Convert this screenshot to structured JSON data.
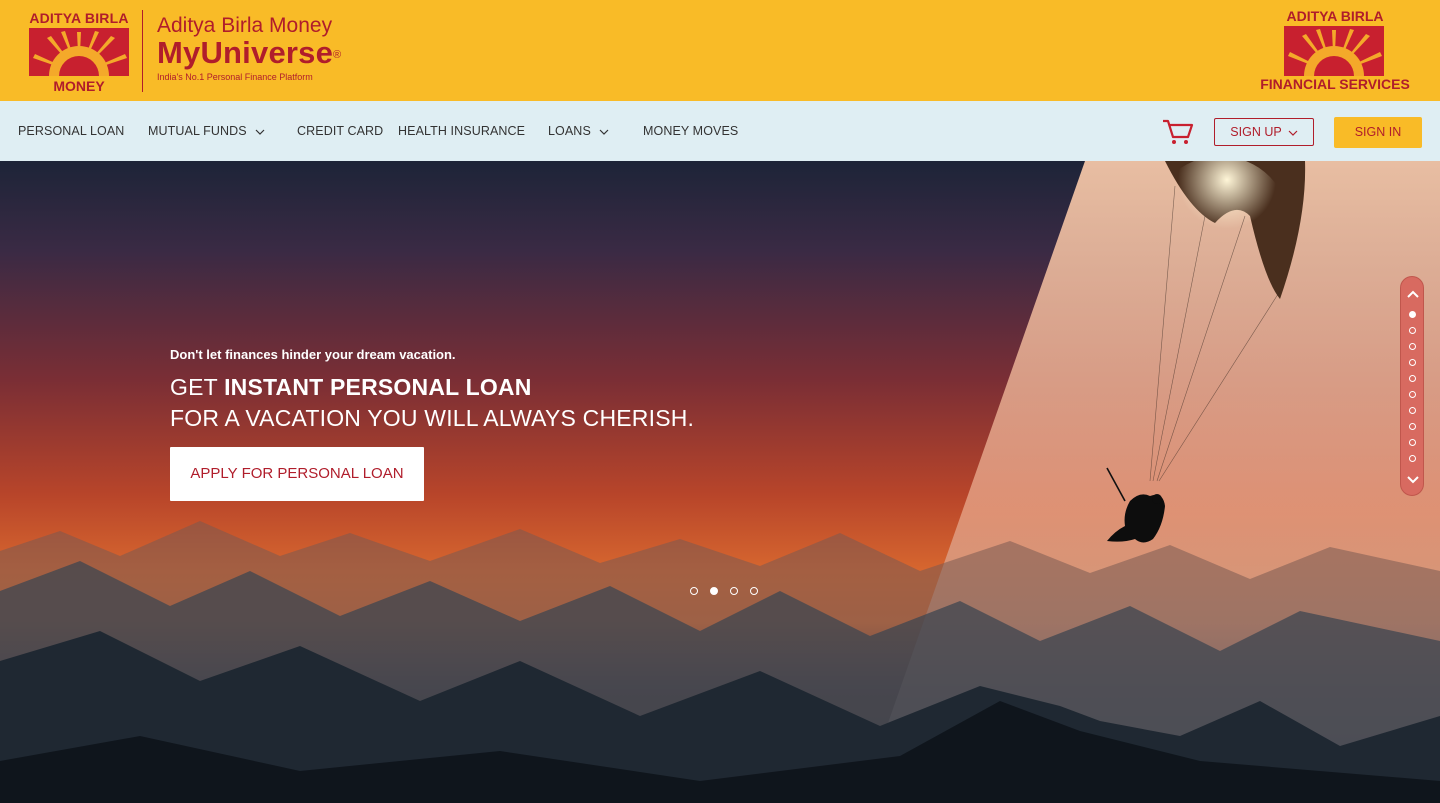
{
  "header": {
    "left_logo": {
      "top": "ADITYA BIRLA",
      "bottom": "MONEY"
    },
    "product": {
      "line1": "Aditya Birla Money",
      "line2": "MyUniverse",
      "reg": "®",
      "tagline": "India's No.1 Personal Finance Platform"
    },
    "right_logo": {
      "top": "ADITYA BIRLA",
      "bottom": "FINANCIAL SERVICES"
    },
    "brand_color": "#f9bb27",
    "accent_color": "#b01d2b"
  },
  "nav": {
    "items": [
      {
        "label": "PERSONAL LOAN",
        "has_dropdown": false
      },
      {
        "label": "MUTUAL FUNDS",
        "has_dropdown": true
      },
      {
        "label": "CREDIT CARD",
        "has_dropdown": false
      },
      {
        "label": "HEALTH INSURANCE",
        "has_dropdown": false
      },
      {
        "label": "LOANS",
        "has_dropdown": true
      },
      {
        "label": "MONEY MOVES",
        "has_dropdown": false
      }
    ],
    "cart_icon": "cart-icon",
    "signup_label": "SIGN UP",
    "signin_label": "SIGN IN"
  },
  "hero": {
    "subtitle": "Don't let finances hinder your dream vacation.",
    "headline_prefix": "GET ",
    "headline_bold": "INSTANT PERSONAL LOAN",
    "headline_line2": "FOR A VACATION YOU WILL ALWAYS CHERISH.",
    "cta_label": "APPLY FOR PERSONAL LOAN",
    "carousel_slide_count": 4,
    "carousel_active_index": 1,
    "section_nav_count": 10,
    "section_nav_active_index": 0
  }
}
